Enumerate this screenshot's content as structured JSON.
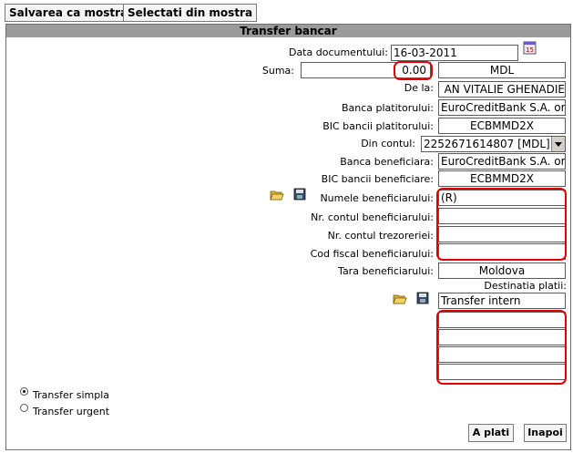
{
  "toolbar": {
    "save_label": "Salvarea ca mostra",
    "select_label": "Selectati din mostra"
  },
  "panel": {
    "title": "Transfer bancar"
  },
  "form": {
    "date_label": "Data documentului:",
    "date_value": "16-03-2011",
    "sum_label": "Suma:",
    "sum_value": "0.00",
    "currency": "MDL",
    "from_label": "De la:",
    "from_value": "AN VITALIE GHENADIE",
    "payer_bank_label": "Banca platitorului:",
    "payer_bank_value": "EuroCreditBank S.A. or.",
    "payer_bic_label": "BIC bancii platitorului:",
    "payer_bic_value": "ECBMMD2X",
    "account_label": "Din contul:",
    "account_value": "2252671614807 [MDL]",
    "benef_bank_label": "Banca beneficiara:",
    "benef_bank_value": "EuroCreditBank S.A. or.",
    "benef_bic_label": "BIC bancii beneficiare:",
    "benef_bic_value": "ECBMMD2X",
    "benef_name_label": "Numele beneficiarului:",
    "benef_name_value": "(R)",
    "benef_account_label": "Nr. contul beneficiarului:",
    "benef_account_value": "",
    "treasury_label": "Nr. contul trezoreriei:",
    "treasury_value": "",
    "fiscal_code_label": "Cod fiscal beneficiarului:",
    "fiscal_code_value": "",
    "country_label": "Tara beneficiarului:",
    "country_value": "Moldova",
    "purpose_label": "Destinatia platii:",
    "purpose_lines": [
      "Transfer intern",
      "",
      "",
      "",
      ""
    ]
  },
  "transfer": {
    "simple_label": "Transfer simpla",
    "urgent_label": "Transfer urgent",
    "selected": "simple"
  },
  "buttons": {
    "pay_label": "A plati",
    "back_label": "Inapoi"
  },
  "colors": {
    "highlight": "#e00000",
    "titlebar": "#9b9b9b"
  },
  "icons": [
    "calendar-icon",
    "open-folder-icon",
    "save-disk-icon",
    "dropdown-arrow-icon"
  ]
}
